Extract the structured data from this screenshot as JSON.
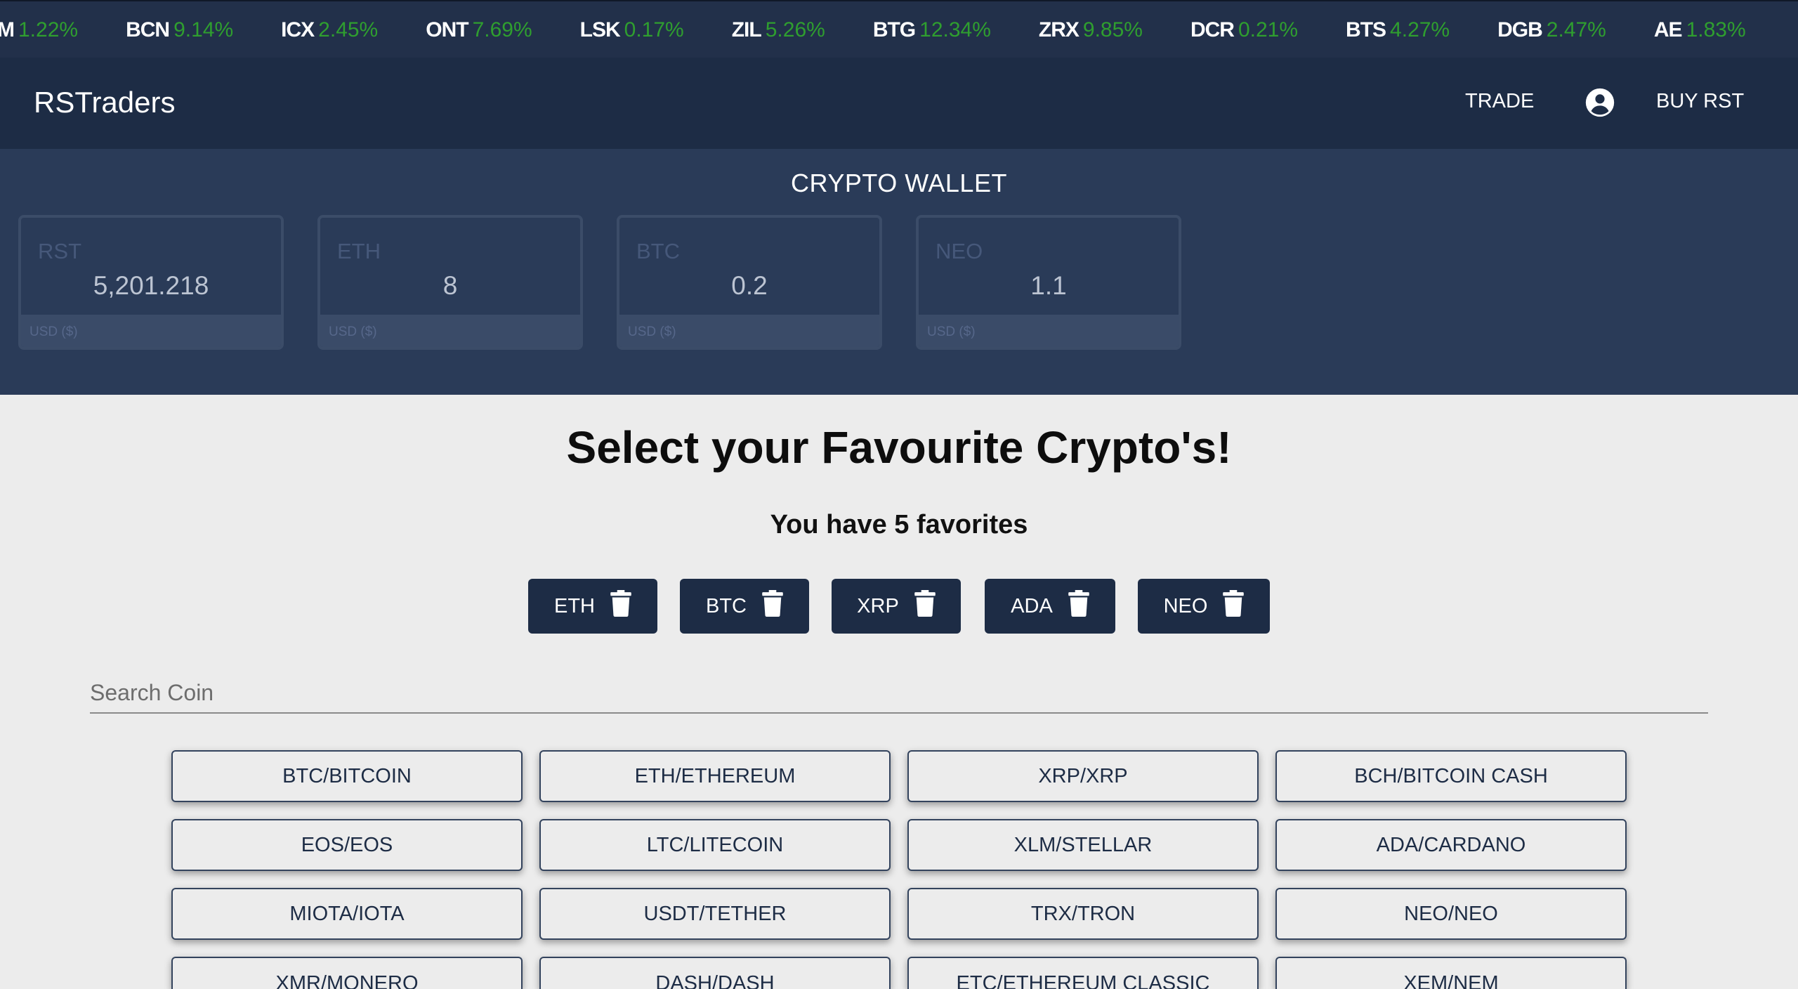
{
  "ticker": [
    {
      "symbol": "M",
      "change": "1.22%"
    },
    {
      "symbol": "BCN",
      "change": "9.14%"
    },
    {
      "symbol": "ICX",
      "change": "2.45%"
    },
    {
      "symbol": "ONT",
      "change": "7.69%"
    },
    {
      "symbol": "LSK",
      "change": "0.17%"
    },
    {
      "symbol": "ZIL",
      "change": "5.26%"
    },
    {
      "symbol": "BTG",
      "change": "12.34%"
    },
    {
      "symbol": "ZRX",
      "change": "9.85%"
    },
    {
      "symbol": "DCR",
      "change": "0.21%"
    },
    {
      "symbol": "BTS",
      "change": "4.27%"
    },
    {
      "symbol": "DGB",
      "change": "2.47%"
    },
    {
      "symbol": "AE",
      "change": "1.83%"
    }
  ],
  "navbar": {
    "brand": "RSTraders",
    "trade_label": "TRADE",
    "account_icon": "account-circle-icon",
    "buy_label": "BUY RST"
  },
  "wallet": {
    "title": "CRYPTO WALLET",
    "cards": [
      {
        "name": "RST",
        "value": "5,201.218",
        "footer": "USD ($)"
      },
      {
        "name": "ETH",
        "value": "8",
        "footer": "USD ($)"
      },
      {
        "name": "BTC",
        "value": "0.2",
        "footer": "USD ($)"
      },
      {
        "name": "NEO",
        "value": "1.1",
        "footer": "USD ($)"
      }
    ]
  },
  "main": {
    "headline": "Select your Favourite Crypto's!",
    "favorites_count_text": "You have 5 favorites",
    "favorites": [
      "ETH",
      "BTC",
      "XRP",
      "ADA",
      "NEO"
    ],
    "favorite_remove_icon": "trash-icon",
    "search_placeholder": "Search Coin",
    "coins": [
      "BTC/BITCOIN",
      "ETH/ETHEREUM",
      "XRP/XRP",
      "BCH/BITCOIN CASH",
      "EOS/EOS",
      "LTC/LITECOIN",
      "XLM/STELLAR",
      "ADA/CARDANO",
      "MIOTA/IOTA",
      "USDT/TETHER",
      "TRX/TRON",
      "NEO/NEO",
      "XMR/MONERO",
      "DASH/DASH",
      "ETC/ETHEREUM CLASSIC",
      "XEM/NEM"
    ]
  },
  "colors": {
    "navy": "#1d2c45",
    "wallet_bg": "#2a3b58",
    "ticker_green": "#2f9e2f",
    "page_bg": "#ececec"
  }
}
